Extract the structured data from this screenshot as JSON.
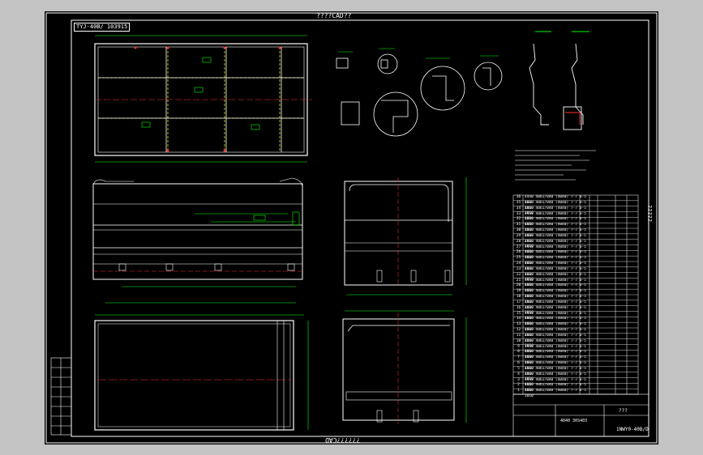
{
  "drawing": {
    "top_banner": "????CAD??",
    "bottom_banner": "??????CAD",
    "corner_code": "TYJ-40B/ 103915",
    "right_side_text": "?????",
    "title_block_code": "1NWY0-40B/D",
    "title_block_name": "???",
    "title_block_sub": "4040 30S403"
  },
  "parts_table": {
    "rows": [
      [
        "36",
        "4440 40b1/040 (4040) 7-7 0-5 1010",
        "",
        ""
      ],
      [
        "35",
        "4440 40b1/040 (4040) 7-7 0-5 1010",
        "",
        ""
      ],
      [
        "34",
        "4440 40b1/040 (4040) 7-7 0-5 1010",
        "",
        ""
      ],
      [
        "33",
        "4440 40b1/040 (4040) 7-7 0-5 1010",
        "",
        ""
      ],
      [
        "32",
        "4440 40b1/040 (4040) 7-7 0-5 1010",
        "",
        ""
      ],
      [
        "31",
        "4440 40b1/040 (4040) 7-7 0-5 1010",
        "",
        ""
      ],
      [
        "30",
        "4440 40b1/040 (4040) 7-7 0-5 1010",
        "",
        ""
      ],
      [
        "29",
        "4440 40b1/040 (4040) 7-7 0-5 1010",
        "",
        ""
      ],
      [
        "28",
        "4440 40b1/040 (4040) 7-7 0-5 1010",
        "",
        ""
      ],
      [
        "27",
        "4440 40b1/040 (4040) 7-7 0-5 1010",
        "",
        ""
      ],
      [
        "26",
        "4440 40b1/040 (4040) 7-7 0-5 1010",
        "",
        ""
      ],
      [
        "25",
        "4440 40b1/040 (4040) 7-7 0-5 1010",
        "",
        ""
      ],
      [
        "24",
        "4440 40b1/040 (4040) 7-7 0-5 1010",
        "",
        ""
      ],
      [
        "23",
        "4440 40b1/040 (4040) 7-7 0-5 1010",
        "",
        ""
      ],
      [
        "22",
        "4440 40b1/040 (4040) 7-7 0-5 1010",
        "",
        ""
      ],
      [
        "21",
        "4440 40b1/040 (4040) 7-7 0-5 1010",
        "",
        ""
      ],
      [
        "20",
        "4440 40b1/040 (4040) 7-7 0-5 1010",
        "",
        ""
      ],
      [
        "19",
        "4440 40b1/040 (4040) 7-7 0-5 1010",
        "",
        ""
      ],
      [
        "18",
        "4440 40b1/040 (4040) 7-7 0-5 1010",
        "",
        ""
      ],
      [
        "17",
        "4440 40b1/040 (4040) 7-7 0-5 1010",
        "",
        ""
      ],
      [
        "16",
        "4440 40b1/040 (4040) 7-7 0-5 1010",
        "",
        ""
      ],
      [
        "15",
        "4440 40b1/040 (4040) 7-7 0-5 1010",
        "",
        ""
      ],
      [
        "14",
        "4440 40b1/040 (4040) 7-7 0-5 1010",
        "",
        ""
      ],
      [
        "13",
        "4440 40b1/040 (4040) 7-7 0-5 1010",
        "",
        ""
      ],
      [
        "12",
        "4440 40b1/040 (4040) 7-7 0-5 1010",
        "",
        ""
      ],
      [
        "11",
        "4440 40b1/040 (4040) 7-7 0-5 1010",
        "",
        ""
      ],
      [
        "10",
        "4440 40b1/040 (4040) 7-7 0-5 1010",
        "",
        ""
      ],
      [
        "9",
        "4440 40b1/040 (4040) 7-7 0-5 1010",
        "",
        ""
      ],
      [
        "8",
        "4440 40b1/040 (4040) 7-7 0-5 1010",
        "",
        ""
      ],
      [
        "7",
        "4440 40b1/040 (4040) 7-7 0-5 1010",
        "",
        ""
      ],
      [
        "6",
        "4440 40b1/040 (4040) 7-7 0-5 1010",
        "",
        ""
      ],
      [
        "5",
        "4440 40b1/040 (4040) 7-7 0-5 1010",
        "",
        ""
      ],
      [
        "4",
        "4440 40b1/040 (4040) 7-7 0-5 1010",
        "",
        ""
      ],
      [
        "3",
        "4440 40b1/040 (4040) 7-7 0-5 1010",
        "",
        ""
      ],
      [
        "2",
        "4440 40b1/040 (4040) 7-7 0-5 1010",
        "",
        ""
      ],
      [
        "1",
        "4440 40b1/040 (4040) 7-7 0-5 1010",
        "",
        ""
      ]
    ]
  },
  "colors": {
    "background": "#000000",
    "frame": "#ffffff",
    "centerline": "#ff3030",
    "dimension": "#00ff00",
    "hidden": "#ffff00",
    "text": "#ffffff"
  }
}
